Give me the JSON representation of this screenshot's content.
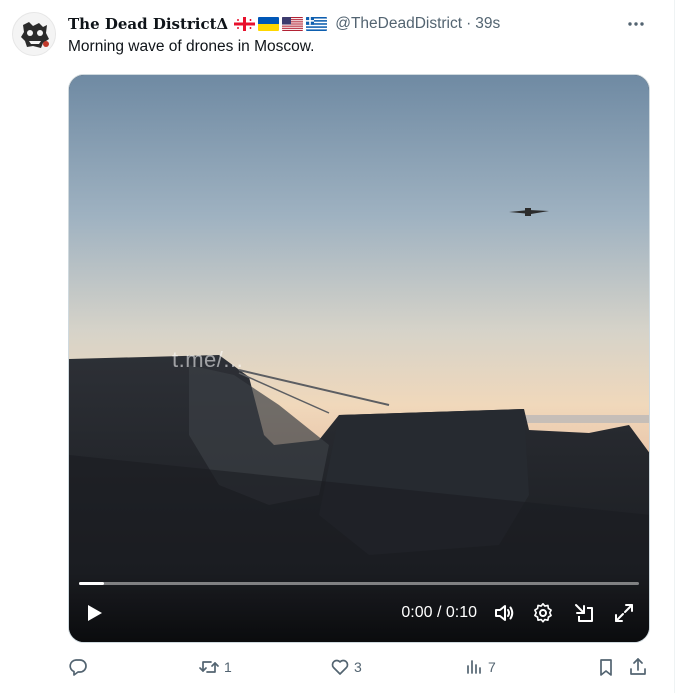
{
  "tweet": {
    "display_name": "The Dead DistrictΔ",
    "handle": "@TheDeadDistrict",
    "separator": "·",
    "time": "39s",
    "text": "Morning wave of drones in Moscow.",
    "flags": [
      "georgia-flag",
      "ukraine-flag",
      "usa-flag",
      "greece-flag"
    ],
    "more_icon": "more-icon"
  },
  "media": {
    "watermark": "t.me/...",
    "time_display": "0:00 / 0:10",
    "progress": 0.045,
    "icons": [
      "play-icon",
      "volume-icon",
      "settings-icon",
      "picture-in-picture-icon",
      "fullscreen-icon"
    ]
  },
  "actions": {
    "reply": {
      "icon": "reply-icon",
      "count": ""
    },
    "repost": {
      "icon": "repost-icon",
      "count": "1"
    },
    "like": {
      "icon": "like-icon",
      "count": "3"
    },
    "views": {
      "icon": "views-icon",
      "count": "7"
    },
    "bookmark": {
      "icon": "bookmark-icon"
    },
    "share": {
      "icon": "share-icon"
    }
  },
  "colors": {
    "text_primary": "#0f1419",
    "text_secondary": "#536471",
    "border": "#cfd9de"
  }
}
